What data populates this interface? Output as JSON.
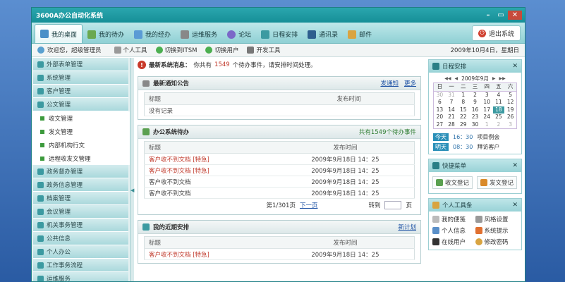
{
  "window": {
    "title": "3600A办公自动化系统",
    "min": "–",
    "max": "▭",
    "close": "✕"
  },
  "nav": {
    "tabs": [
      "我的桌面",
      "我的待办",
      "我的经办",
      "运维服务",
      "论坛",
      "日程安排",
      "通讯录",
      "邮件"
    ],
    "exit": "退出系统"
  },
  "toolbar": {
    "welcome": "欢迎您，超级管理员",
    "items": [
      "个人工具",
      "切换到ITSM",
      "切换用户",
      "开发工具"
    ],
    "date": "2009年10月4日，星期日"
  },
  "sidebar": {
    "before": [
      "外部表单管理",
      "系统管理",
      "客户管理",
      "公文管理"
    ],
    "subs": [
      "收文管理",
      "发文管理",
      "内部机构行文",
      "远程收发文管理"
    ],
    "after": [
      "政务督办管理",
      "政务信息管理",
      "档案管理",
      "会议管理",
      "机关事务管理",
      "公共信息",
      "个人办公",
      "工作事务流程",
      "运维服务"
    ]
  },
  "notice": {
    "label": "最新系统消息：",
    "pre": "你共有",
    "count": "1549",
    "post": "个待办事件，请安排时间处理。"
  },
  "announce": {
    "title": "最新通知公告",
    "link1": "发通知",
    "link2": "更多",
    "col1": "标题",
    "col2": "发布时间",
    "empty": "没有记录"
  },
  "todo": {
    "title": "办公系统待办",
    "summary": "共有1549个待办事件",
    "col1": "标题",
    "col2": "发布时间",
    "rows": [
      {
        "t": "客户收不到文档 [特急]",
        "d": "2009年9月18日 14：25",
        "red": true
      },
      {
        "t": "客户收不到文档 [特急]",
        "d": "2009年9月18日 14：25",
        "red": true
      },
      {
        "t": "客户收不到文档",
        "d": "2009年9月18日 14：25",
        "red": false
      },
      {
        "t": "客户收不到文档",
        "d": "2009年9月18日 14：25",
        "red": false
      }
    ],
    "page": "第1/301页",
    "next": "下一页",
    "goto": "转到",
    "unit": "页"
  },
  "recent": {
    "title": "我的近期安排",
    "link": "新计划",
    "col1": "标题",
    "col2": "发布时间",
    "rows": [
      {
        "t": "客户收不到文档 [特急]",
        "d": "2009年9月18日 14：25",
        "red": true
      }
    ]
  },
  "calendar": {
    "title": "日程安排",
    "month": "2009年9月",
    "week": [
      "日",
      "一",
      "二",
      "三",
      "四",
      "五",
      "六"
    ],
    "days": [
      "30",
      "31",
      "1",
      "2",
      "3",
      "4",
      "5",
      "6",
      "7",
      "8",
      "9",
      "10",
      "11",
      "12",
      "13",
      "14",
      "15",
      "16",
      "17",
      "18",
      "19",
      "20",
      "21",
      "22",
      "23",
      "24",
      "25",
      "26",
      "27",
      "28",
      "29",
      "30",
      "1",
      "2",
      "3"
    ]
  },
  "schedule": [
    {
      "label": "今天",
      "time": "16：30",
      "text": "项目例会"
    },
    {
      "label": "明天",
      "time": "08：30",
      "text": "拜访客户"
    }
  ],
  "shortcut": {
    "title": "快捷菜单",
    "items": [
      "收文登记",
      "发文登记"
    ]
  },
  "tools": {
    "title": "个人工具条",
    "items": [
      "我的便笺",
      "风格设置",
      "个人信息",
      "系统提示",
      "在线用户",
      "修改密码"
    ]
  }
}
